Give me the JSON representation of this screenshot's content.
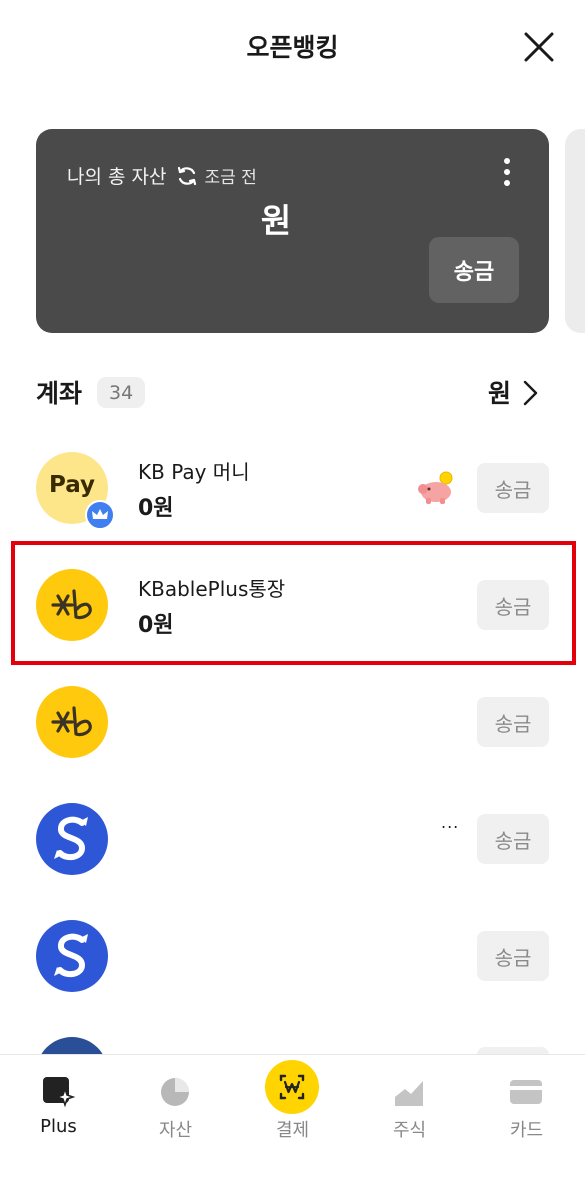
{
  "header": {
    "title": "오픈뱅킹",
    "close_icon": "close-icon"
  },
  "asset_card": {
    "label": "나의 총 자산",
    "refresh_time": "조금 전",
    "amount": "원",
    "send_label": "송금"
  },
  "accounts_section": {
    "title": "계좌",
    "count": "34",
    "total": "원"
  },
  "accounts": [
    {
      "logo": "kb-pay-logo",
      "logo_text": "Pay",
      "name": "KB Pay 머니",
      "balance": "0원",
      "send_label": "송금"
    },
    {
      "logo": "kb-logo",
      "name": "KBablePlus통장",
      "balance": "0원",
      "send_label": "송금"
    },
    {
      "logo": "kb-logo",
      "name": "",
      "balance": "",
      "send_label": "송금"
    },
    {
      "logo": "shinhan-logo",
      "name": "",
      "balance": "",
      "extra": "...",
      "send_label": "송금"
    },
    {
      "logo": "shinhan-logo",
      "name": "",
      "balance": "",
      "send_label": "송금"
    }
  ],
  "bottom_nav": [
    {
      "label": "Plus",
      "icon": "plus-sparkle-icon",
      "active": true
    },
    {
      "label": "자산",
      "icon": "pie-chart-icon",
      "active": false
    },
    {
      "label": "결제",
      "icon": "won-scan-icon",
      "active": false
    },
    {
      "label": "주식",
      "icon": "stock-chart-icon",
      "active": false
    },
    {
      "label": "카드",
      "icon": "card-icon",
      "active": false
    }
  ],
  "colors": {
    "card_bg": "#4a4a4a",
    "highlight": "#e3000b",
    "kb_yellow": "#ffc90e",
    "shinhan_blue": "#2e57d8",
    "pay_yellow": "#ffd400"
  }
}
